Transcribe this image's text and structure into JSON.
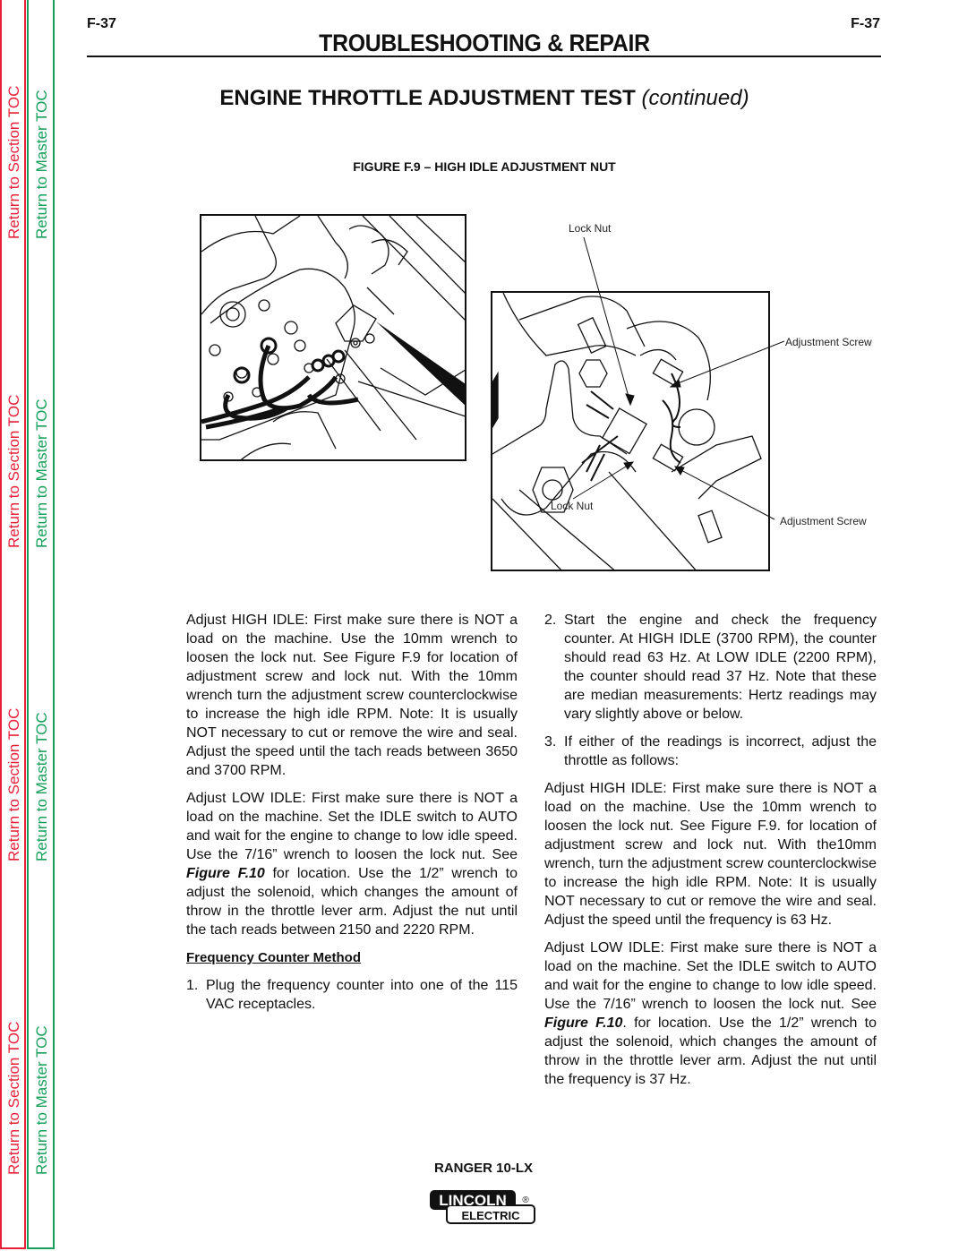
{
  "sidebar": {
    "section_toc_label": "Return to Section TOC",
    "master_toc_label": "Return to Master TOC",
    "section_color": "#e8203a",
    "master_color": "#16a05a"
  },
  "header": {
    "page_number_left": "F-37",
    "page_number_right": "F-37",
    "title": "TROUBLESHOOTING & REPAIR"
  },
  "section": {
    "title": "ENGINE THROTTLE ADJUSTMENT TEST",
    "title_suffix": "(continued)"
  },
  "figure": {
    "title": "FIGURE F.9 – HIGH IDLE ADJUSTMENT NUT",
    "callouts": {
      "lock_nut_top": "Lock Nut",
      "adjustment_screw_top": "Adjustment Screw",
      "lock_nut_bottom": "Lock Nut",
      "adjustment_screw_bottom": "Adjustment Screw"
    }
  },
  "left_column": {
    "high_idle_paragraph": "Adjust HIGH IDLE:  First make sure there is NOT a load on the machine.  Use the 10mm wrench to loosen the lock nut.  See Figure F.9 for location of adjustment screw and lock nut. With the 10mm wrench turn the adjustment screw counterclockwise to increase the high idle RPM. Note:  It is usually NOT necessary to cut or remove the wire and seal.  Adjust the speed until the tach reads between 3650 and 3700 RPM.",
    "low_idle_paragraph_before": "Adjust LOW IDLE:  First make sure there is NOT a load on the machine.  Set the IDLE switch to AUTO and wait for the engine to change to low idle speed.  Use the 7/16” wrench to loosen the lock nut.  See ",
    "low_idle_figref": "Figure F.10",
    "low_idle_paragraph_after": " for location.  Use the 1/2” wrench to adjust the solenoid, which changes the amount of throw in the throttle lever arm.  Adjust the nut until the tach reads between 2150 and 2220 RPM.",
    "frequency_heading": "Frequency Counter Method",
    "steps": [
      {
        "num": "1.",
        "text": "Plug the frequency counter into one of the 115 VAC receptacles."
      }
    ]
  },
  "right_column": {
    "steps": [
      {
        "num": "2.",
        "text": "Start the engine and check the frequency counter.   At HIGH IDLE (3700  RPM),  the counter should read 63 Hz.  At LOW IDLE (2200 RPM), the counter should read 37 Hz. Note that these are median measurements: Hertz readings may vary slightly above or below."
      },
      {
        "num": "3.",
        "text": "If either of the readings is incorrect, adjust the throttle as follows:"
      }
    ],
    "high_idle_paragraph": "Adjust HIGH IDLE:  First make sure there is NOT a load on the machine.  Use the 10mm wrench to loosen the lock nut.  See Figure F.9. for location of adjustment screw and lock nut. With the10mm wrench, turn the adjustment screw counterclockwise to increase the high idle RPM.  Note: It is usually NOT necessary to cut or remove the wire and seal.  Adjust the speed until the frequency is 63 Hz.",
    "low_idle_paragraph_before": "Adjust LOW IDLE:  First make sure there is NOT a load on the machine.  Set the IDLE switch to AUTO and wait for the engine to change to low idle speed.  Use the 7/16” wrench to loosen the lock nut.  See ",
    "low_idle_figref": "Figure F.10",
    "low_idle_paragraph_after": ".  for location.  Use the 1/2” wrench to adjust the solenoid, which changes the amount of throw in the throttle lever arm.  Adjust the nut until the frequency is 37 Hz."
  },
  "footer": {
    "model": "RANGER 10-LX",
    "logo_top": "LINCOLN",
    "logo_bottom": "ELECTRIC",
    "logo_mark": "®"
  }
}
